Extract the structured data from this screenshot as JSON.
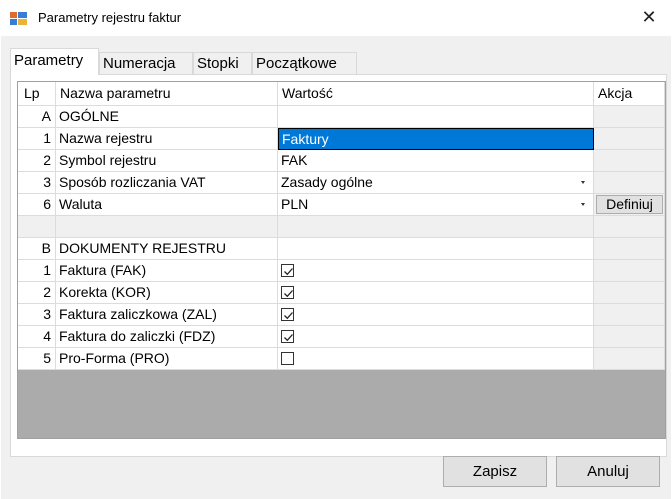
{
  "window": {
    "title": "Parametry rejestru faktur",
    "close_symbol": "✕"
  },
  "tabs": [
    {
      "label": "Parametry",
      "active": true
    },
    {
      "label": "Numeracja",
      "active": false
    },
    {
      "label": "Stopki",
      "active": false
    },
    {
      "label": "Początkowe",
      "active": false
    }
  ],
  "grid": {
    "headers": {
      "lp": "Lp",
      "name": "Nazwa parametru",
      "value": "Wartość",
      "action": "Akcja"
    },
    "rows": [
      {
        "lp": "A",
        "name": "OGÓLNE",
        "value": ""
      },
      {
        "lp": "1",
        "name": "Nazwa rejestru",
        "value": "Faktury"
      },
      {
        "lp": "2",
        "name": "Symbol rejestru",
        "value": "FAK"
      },
      {
        "lp": "3",
        "name": "Sposób rozliczania VAT",
        "value": "Zasady ogólne"
      },
      {
        "lp": "6",
        "name": "Waluta",
        "value": "PLN",
        "action": "Definiuj"
      },
      {
        "lp": "",
        "name": "",
        "value": ""
      },
      {
        "lp": "B",
        "name": "DOKUMENTY REJESTRU",
        "value": ""
      },
      {
        "lp": "1",
        "name": "Faktura (FAK)",
        "checked": true
      },
      {
        "lp": "2",
        "name": "Korekta (KOR)",
        "checked": true
      },
      {
        "lp": "3",
        "name": "Faktura zaliczkowa (ZAL)",
        "checked": true
      },
      {
        "lp": "4",
        "name": "Faktura do zaliczki (FDZ)",
        "checked": true
      },
      {
        "lp": "5",
        "name": "Pro-Forma (PRO)",
        "checked": false
      }
    ]
  },
  "buttons": {
    "save": "Zapisz",
    "cancel": "Anuluj"
  },
  "colors": {
    "selection": "#0078d7",
    "grid_empty": "#ababab",
    "window_bg": "#f0f0f0"
  }
}
